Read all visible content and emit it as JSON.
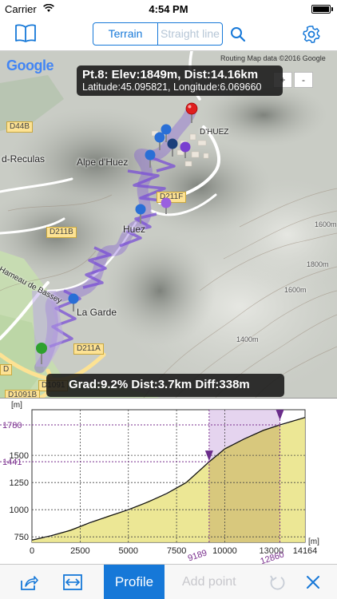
{
  "status": {
    "carrier": "Carrier",
    "time": "4:54 PM"
  },
  "nav": {
    "seg_terrain": "Terrain",
    "seg_straight": "Straight line"
  },
  "map": {
    "google": "Google",
    "attribution": "Routing Map data ©2016 Google",
    "zoom_in": "+",
    "zoom_out": "-",
    "tooltip_line1": "Pt.8: Elev:1849m, Dist:14.16km",
    "tooltip_line2": "Latitude:45.095821, Longitude:6.069660",
    "segment_info": "Grad:9.2% Dist:3.7km Diff:338m",
    "roads": [
      "D44B",
      "D211F",
      "D211B",
      "D211A",
      "D1091",
      "D1091B",
      "D"
    ],
    "places": [
      "d-Reculas",
      "Alpe d'Huez",
      "D'HUEZ",
      "Huez",
      "La Garde",
      "Hameau de Bassey",
      "1800m",
      "1600m",
      "1600m",
      "1400m"
    ]
  },
  "chart_data": {
    "type": "area",
    "ylabel": "[m]",
    "xlabel": "[m]",
    "xlim": [
      0,
      14164
    ],
    "ylim": [
      700,
      1920
    ],
    "x_ticks": [
      0,
      2500,
      5000,
      7500,
      10000,
      14164
    ],
    "y_ticks": [
      750,
      1000,
      1250,
      1500
    ],
    "x": [
      0,
      1000,
      2000,
      3000,
      4000,
      5000,
      6000,
      7000,
      8000,
      9189,
      10000,
      11000,
      12000,
      12860,
      14164
    ],
    "values": [
      720,
      760,
      810,
      880,
      940,
      1000,
      1070,
      1150,
      1250,
      1441,
      1560,
      1650,
      1730,
      1780,
      1849
    ],
    "selection": {
      "start_x": 9189,
      "end_x": 12860,
      "start_y": 1441,
      "end_y": 1780
    },
    "selection_labels": {
      "start_x": "9189",
      "end_x": "12860",
      "start_y": "1441",
      "end_y": "1780"
    },
    "x_overlap_label": "13000"
  },
  "toolbar": {
    "profile": "Profile",
    "add_point": "Add point"
  },
  "colors": {
    "accent": "#1678d8",
    "route": "#7a4fd6",
    "selection": "#7a2f8e"
  }
}
